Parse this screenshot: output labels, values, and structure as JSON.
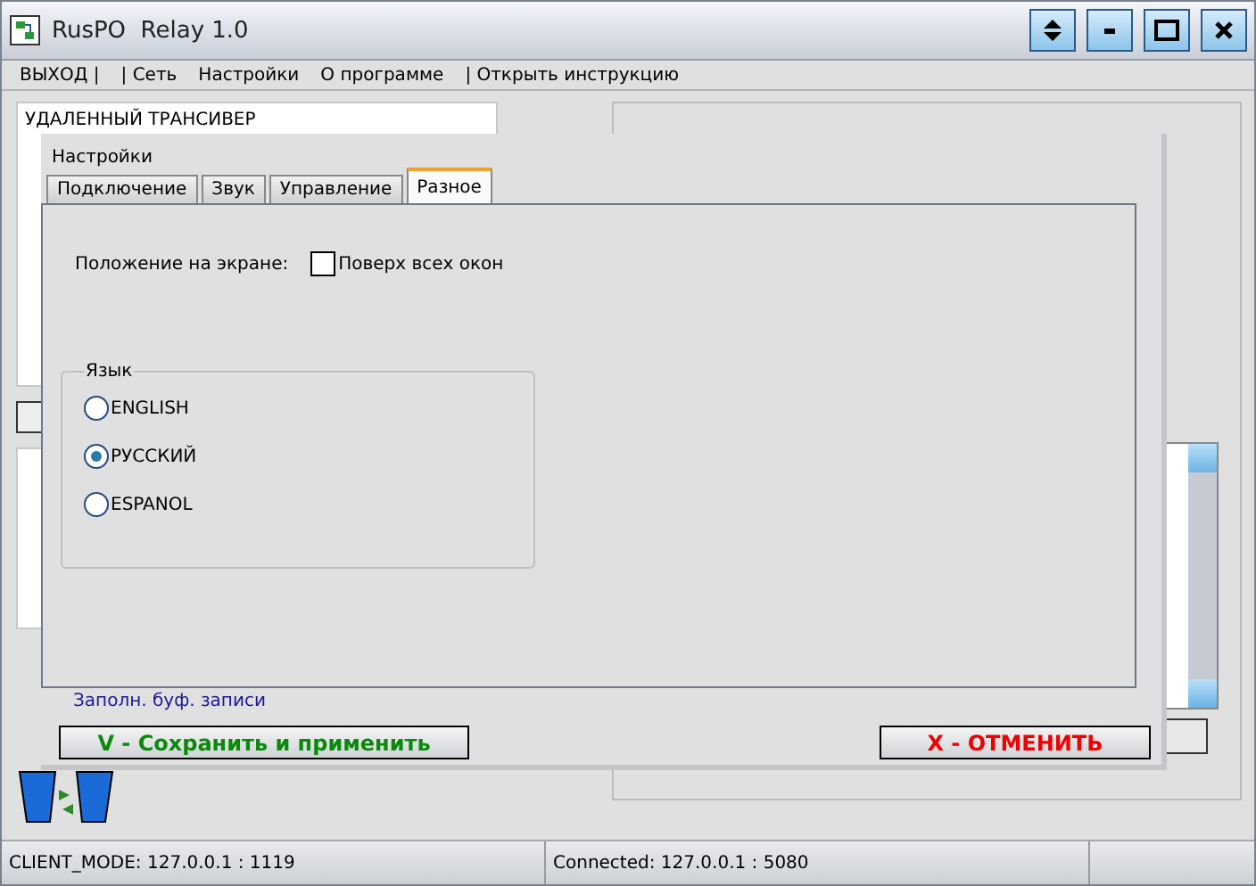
{
  "window": {
    "title": "RusPO  Relay 1.0"
  },
  "menu": [
    "ВЫХОД |",
    "| Сеть",
    "Настройки",
    "О программе",
    "| Открыть инструкцию"
  ],
  "remote_panel": {
    "title": "УДАЛЕННЫЙ ТРАНСИВЕР"
  },
  "dialog": {
    "title": "Настройки",
    "tabs": [
      {
        "label": "Подключение",
        "selected": false
      },
      {
        "label": "Звук",
        "selected": false
      },
      {
        "label": "Управление",
        "selected": false
      },
      {
        "label": "Разное",
        "selected": true
      }
    ],
    "position_label": "Положение на экране:",
    "on_top": {
      "label": "Поверх всех окон",
      "checked": false
    },
    "language": {
      "title": "Язык",
      "options": [
        {
          "label": "ENGLISH",
          "selected": false
        },
        {
          "label": "РУССКИЙ",
          "selected": true
        },
        {
          "label": "ESPANOL",
          "selected": false
        }
      ]
    },
    "buffer_label": "Заполн. буф. записи",
    "save_button": "V - Сохранить и применить",
    "cancel_button": "X - ОТМЕНИТЬ"
  },
  "status_bar": [
    "CLIENT_MODE: 127.0.0.1 : 1119",
    "Connected: 127.0.0.1 : 5080"
  ]
}
